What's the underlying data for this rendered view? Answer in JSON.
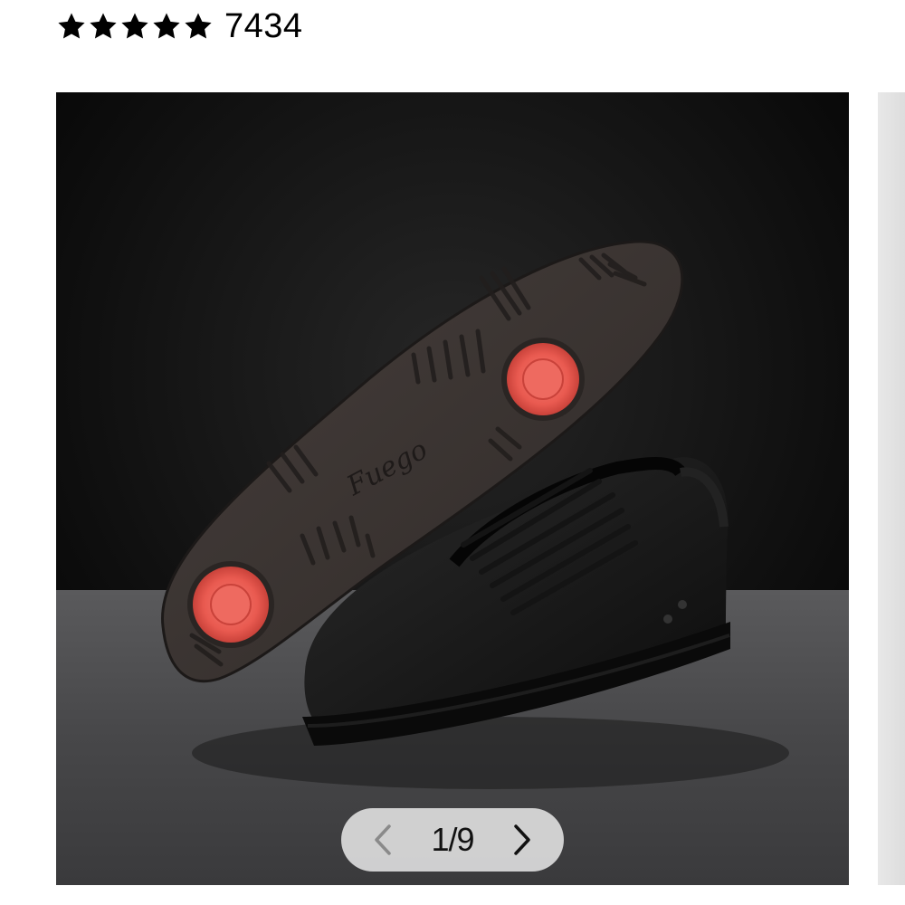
{
  "rating": {
    "stars": 5,
    "max_stars": 5,
    "review_count": "7434"
  },
  "gallery": {
    "pager_text": "1/9",
    "current_index": 1,
    "total": 9,
    "prev_icon": "chevron-left-icon",
    "next_icon": "chevron-right-icon",
    "image_logo_text": "Fuego"
  },
  "colors": {
    "star": "#000000",
    "sole": "#3b3533",
    "sole_pad": "#ee5f55",
    "background_dark": "#0a0a0a",
    "floor": "#4a4a4c"
  }
}
